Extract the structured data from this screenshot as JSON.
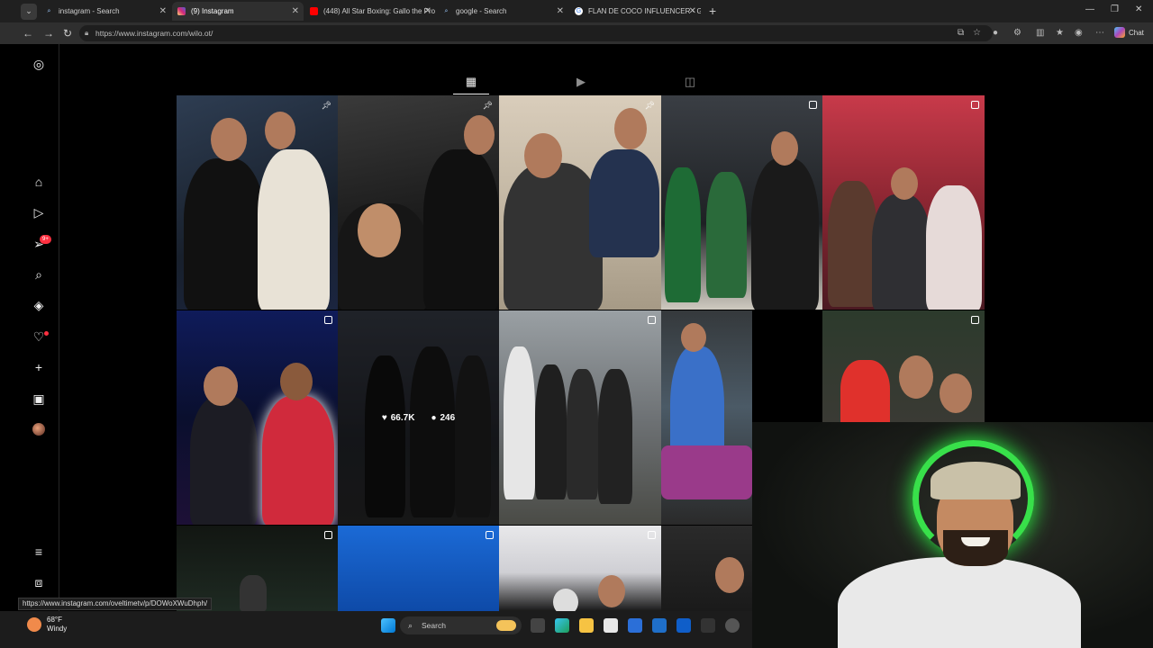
{
  "browser": {
    "tabs": [
      {
        "label": "instagram - Search",
        "icon": "search-icon"
      },
      {
        "label": "(9) Instagram",
        "icon": "instagram-icon"
      },
      {
        "label": "(448) All Star Boxing: Gallo the Pro",
        "icon": "youtube-icon"
      },
      {
        "label": "google - Search",
        "icon": "search-icon"
      },
      {
        "label": "FLAN DE COCO INFLUENCER - Go",
        "icon": "google-icon"
      }
    ],
    "url": "https://www.instagram.com/wilo.ot/",
    "chat_label": "Chat"
  },
  "instagram": {
    "notification_badge": "9+",
    "grid": {
      "hover_likes": "66.7K",
      "hover_comments": "246"
    }
  },
  "status_url": "https://www.instagram.com/oveltimetv/p/DOWoXWuDhph/",
  "taskbar": {
    "temperature": "68°F",
    "condition": "Windy",
    "search_label": "Search"
  },
  "colors": {
    "background": "#000000",
    "notification": "#ff3040",
    "webcam_glow": "#38e04a"
  }
}
